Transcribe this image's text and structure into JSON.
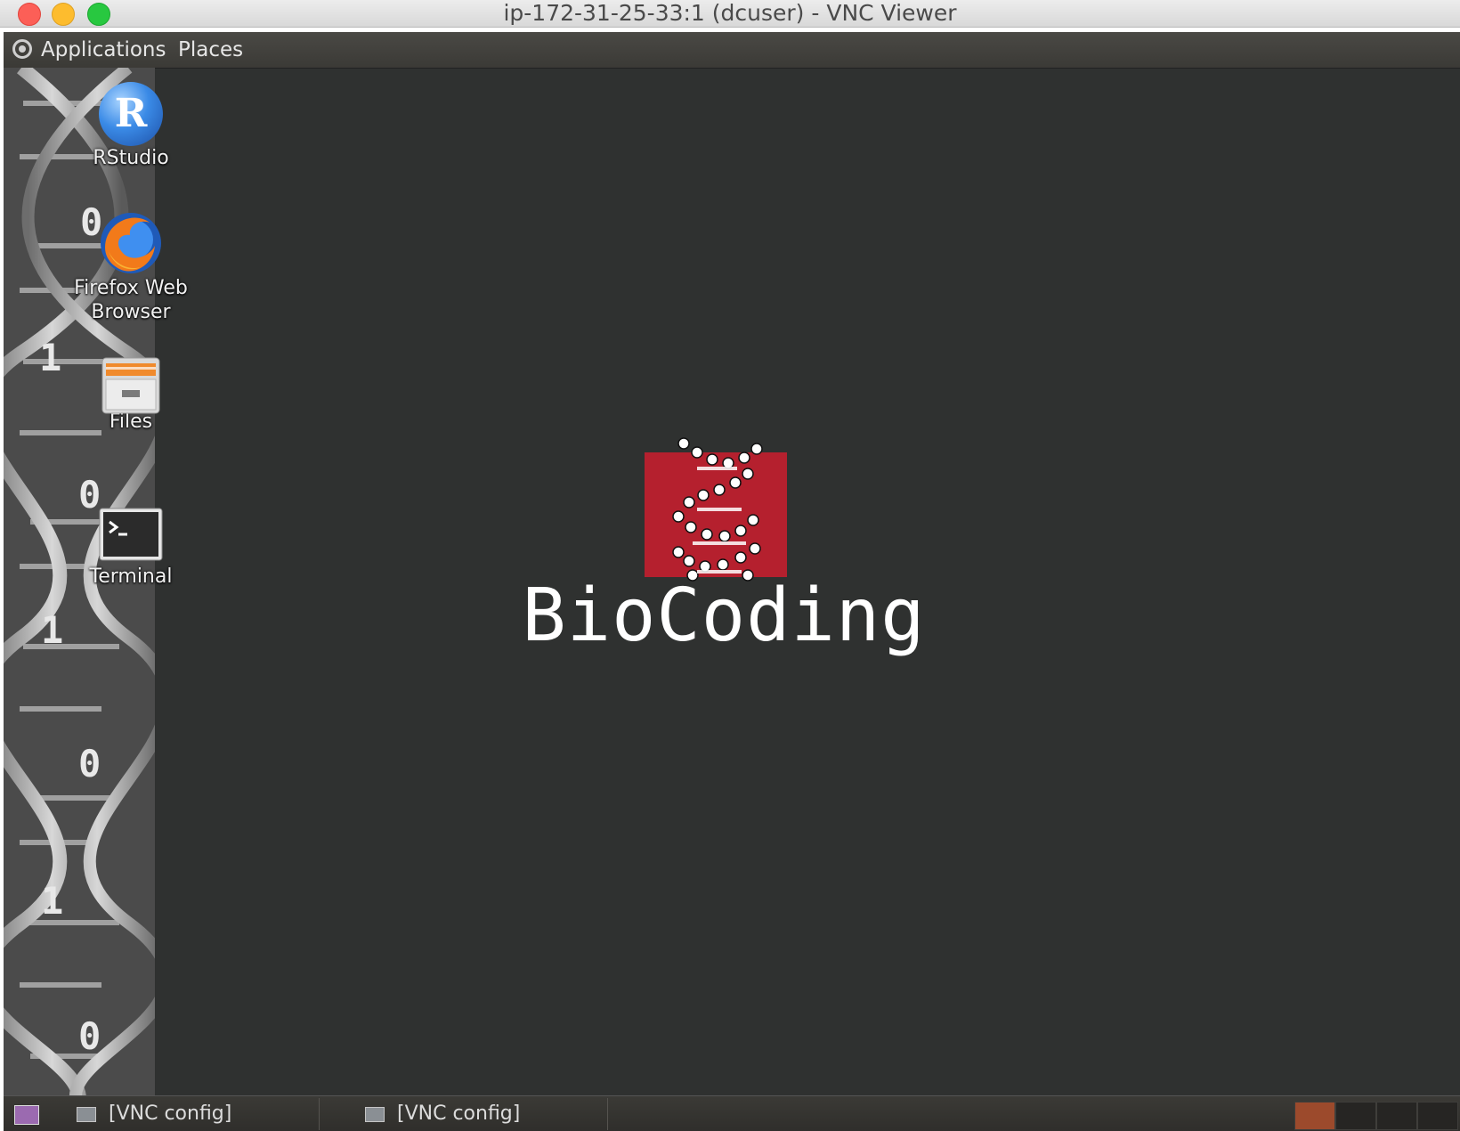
{
  "window": {
    "title": "ip-172-31-25-33:1 (dcuser) - VNC Viewer"
  },
  "topbar": {
    "applications_label": "Applications",
    "places_label": "Places"
  },
  "desktop_icons": [
    {
      "label": "RStudio",
      "icon": "rstudio-icon"
    },
    {
      "label": "Firefox Web Browser",
      "icon": "firefox-icon"
    },
    {
      "label": "Files",
      "icon": "files-icon"
    },
    {
      "label": "Terminal",
      "icon": "terminal-icon"
    }
  ],
  "wallpaper": {
    "logo_text": "BioCoding",
    "digits": [
      "0",
      "1",
      "0",
      "1",
      "0",
      "1",
      "0"
    ]
  },
  "taskbar": {
    "tasks": [
      {
        "label": "[VNC config]"
      },
      {
        "label": "[VNC config]"
      }
    ],
    "workspaces": 4,
    "active_workspace": 1
  },
  "colors": {
    "desktop_bg": "#2f3130",
    "logo_red": "#b5202e",
    "active_workspace": "#9c4a2c"
  }
}
